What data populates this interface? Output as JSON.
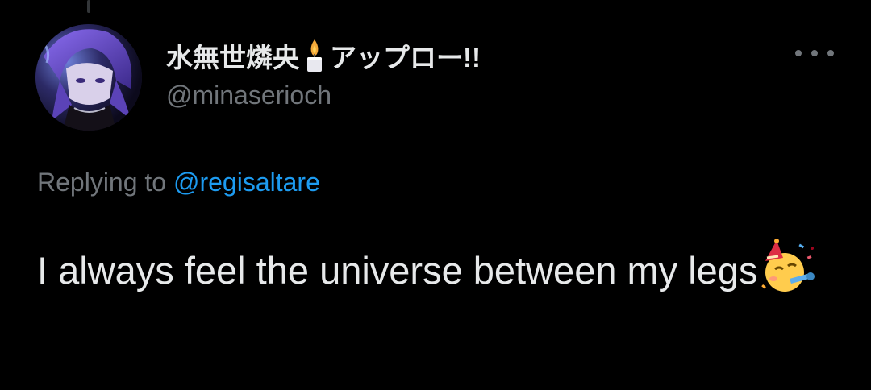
{
  "tweet": {
    "display_name_part1": "水無世燐央",
    "display_name_part2": "アップロー!!",
    "handle": "@minaserioch",
    "replying_prefix": "Replying to ",
    "reply_to": "@regisaltare",
    "text": "I always feel the universe between my legs"
  },
  "icons": {
    "name_emoji": "candle-icon",
    "text_emoji": "partying-face-icon",
    "menu": "more-options-icon"
  },
  "colors": {
    "background": "#000000",
    "primary_text": "#e7e9ea",
    "secondary_text": "#71767b",
    "link": "#1d9bf0"
  }
}
